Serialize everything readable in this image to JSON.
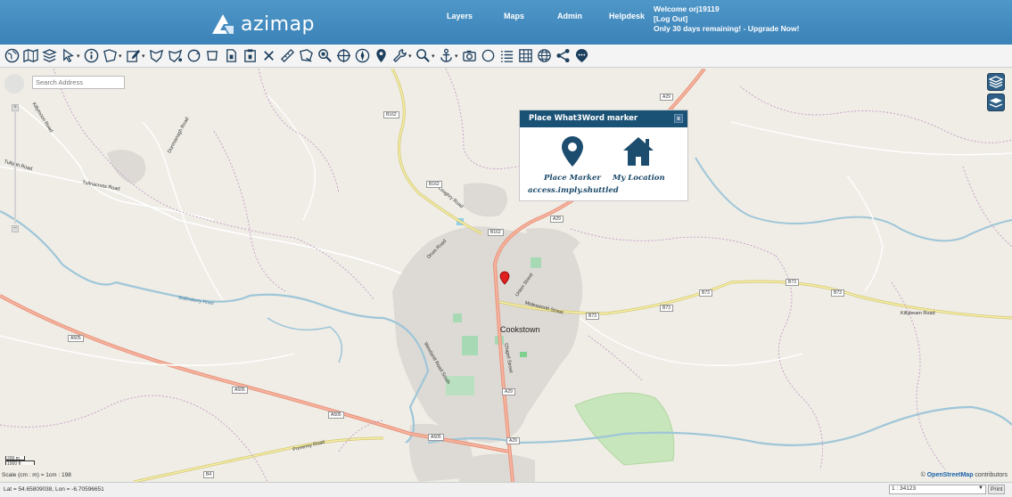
{
  "header": {
    "logo_text": "azimap",
    "nav": [
      {
        "label": "Layers"
      },
      {
        "label": "Maps"
      },
      {
        "label": "Admin"
      },
      {
        "label": "Helpdesk"
      }
    ],
    "welcome": "Welcome orj19119",
    "logout": "[Log Out]",
    "upgrade": "Only 30 days remaining! - Upgrade Now!"
  },
  "toolbar": {
    "icons": [
      "globe-icon",
      "world-map-icon",
      "layers-stack-icon",
      "pointer-icon",
      "info-icon",
      "select-polygon-icon",
      "edit-icon",
      "draw-polygon-icon",
      "draw-shape-icon",
      "rotate-icon",
      "shape-icon",
      "page-icon",
      "clipboard-icon",
      "delete-icon",
      "measure-icon",
      "area-measure-icon",
      "zoom-area-icon",
      "crosshair-icon",
      "compass-icon",
      "marker-icon",
      "wrench-icon",
      "magnify-icon",
      "anchor-icon",
      "camera-icon",
      "circle-icon",
      "legend-list-icon",
      "table-icon",
      "web-icon",
      "share-icon",
      "what3words-icon"
    ]
  },
  "search": {
    "placeholder": "Search Address"
  },
  "popup": {
    "title": "Place What3Word marker",
    "close": "x",
    "place_marker": "Place Marker",
    "my_location": "My Location",
    "w3w_address": "access.imply.shuttled"
  },
  "map": {
    "town": "Cookstown",
    "labels": {
      "killymoon": "Killymoon Road",
      "tullaghoge": "Tullagh Road",
      "tullnacross": "Tullnacross Road",
      "dunmanagh": "Dunmanagh Road",
      "loughry": "Loughry Road",
      "drum": "Drum Road",
      "union": "Union Street",
      "molesworth": "Molesworth Street",
      "chapel": "Chapel Street",
      "westland": "Westland Road South",
      "pomeroy": "Pomeroy Road",
      "ballinderry": "Ballinderry River",
      "killybeam": "Killybeam Road"
    },
    "shields": {
      "a29_top": "A29",
      "a29_mid": "A29",
      "a29_low1": "A29",
      "a29_low2": "A29",
      "b162_a": "B162",
      "b162_b": "B162",
      "b162_c": "B162",
      "b73_a": "B73",
      "b73_b": "B73",
      "b73_c": "B73",
      "b73_d": "B73",
      "b73_e": "B73",
      "a505_a": "A505",
      "a505_b": "A505",
      "a505_c": "A505",
      "a505_d": "A505",
      "b4": "B4"
    },
    "scale_m": "200 m",
    "scale_ft": "1000 ft",
    "scale_text": "Scale (cm : m) = 1cm : 198",
    "attribution_prefix": "©",
    "attribution_link": "OpenStreetMap",
    "attribution_suffix": "contributors"
  },
  "status": {
    "coords": "Lat = 54.65809038, Lon = -6.70596651",
    "scale_value": "1 : 34123",
    "print_label": "Print"
  },
  "colors": {
    "header": "#3b82b8",
    "popup_header": "#1a5276",
    "road_primary": "#e8937a",
    "road_secondary": "#f0e9a0",
    "river": "#9fc6d8"
  }
}
